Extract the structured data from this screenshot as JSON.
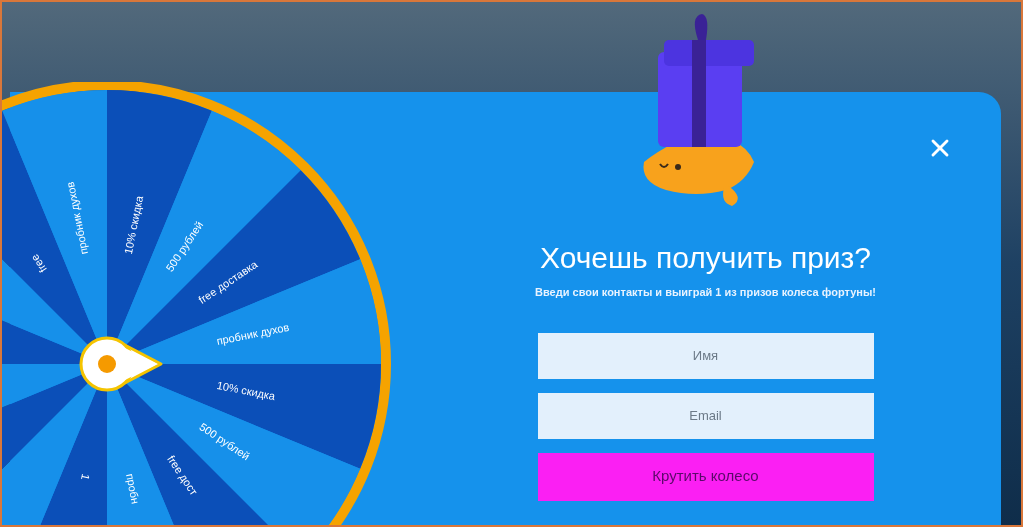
{
  "wheel": {
    "labels": [
      "free",
      "пробник духов",
      "10% скидка",
      "500 рублей",
      "free доставка",
      "пробник духов",
      "10% скидка",
      "500 рублей",
      "free дост",
      "пробн",
      "1"
    ]
  },
  "popup": {
    "title": "Хочешь получить приз?",
    "subtitle": "Введи свои контакты и выиграй 1 из призов колеса фортуны!",
    "fields": [
      {
        "placeholder": "Имя"
      },
      {
        "placeholder": "Email"
      }
    ],
    "button": "Крутить колесо"
  }
}
